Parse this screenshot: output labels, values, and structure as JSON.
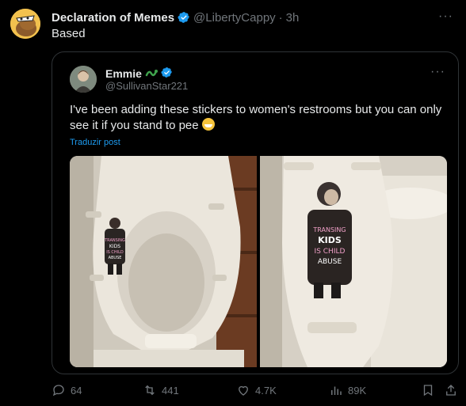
{
  "tweet": {
    "author_name": "Declaration of Memes",
    "author_handle": "@LibertyCappy",
    "separator": "·",
    "time": "3h",
    "text": "Based"
  },
  "quote": {
    "author_name": "Emmie",
    "author_handle": "@SullivanStar221",
    "text": "I've been adding these stickers to women's restrooms but you can only see it if you stand to pee",
    "translate_label": "Traduzir post",
    "sticker_left": [
      "TRANSING",
      "KIDS",
      "IS CHILD",
      "ABUSE"
    ],
    "sticker_right": [
      "TRANSING",
      "KIDS",
      "IS CHILD",
      "ABUSE"
    ]
  },
  "actions": {
    "replies": "64",
    "reposts": "441",
    "likes": "4.7K",
    "views": "89K"
  },
  "colors": {
    "accent": "#1d9bf0",
    "muted": "#71767b",
    "border": "#2f3336",
    "repost": "#00ba7c"
  },
  "icons": [
    "verified-badge-icon",
    "more-icon",
    "reply-icon",
    "repost-icon",
    "like-icon",
    "views-icon",
    "bookmark-icon",
    "share-icon",
    "snake-emoji-icon",
    "grinning-emoji-icon"
  ]
}
